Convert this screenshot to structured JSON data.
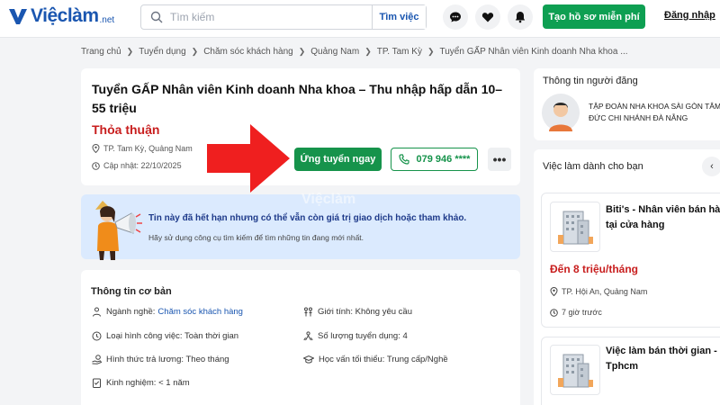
{
  "header": {
    "logo_text": "Việclàm",
    "logo_suffix": ".net",
    "search_placeholder": "Tìm kiếm",
    "search_button": "Tìm việc",
    "create_profile": "Tạo hồ sơ miễn phí",
    "login": "Đăng nhập",
    "icons": [
      "chat-icon",
      "heart-icon",
      "bell-icon"
    ]
  },
  "breadcrumb": [
    "Trang chủ",
    "Tuyển dụng",
    "Chăm sóc khách hàng",
    "Quảng Nam",
    "TP. Tam Kỳ",
    "Tuyển GẤP Nhân viên Kinh doanh Nha khoa ..."
  ],
  "job": {
    "title": "Tuyển GẤP Nhân viên Kinh doanh Nha khoa – Thu nhập hấp dẫn 10–55 triệu",
    "salary": "Thỏa thuận",
    "location": "TP. Tam Kỳ, Quảng Nam",
    "updated": "Cập nhật: 22/10/2025",
    "apply_label": "Ứng tuyển ngay",
    "phone_label": "079 946 ****",
    "more_label": "•••"
  },
  "notice": {
    "title": "Tin này đã hết hạn nhưng có thể vẫn còn giá trị giao dịch hoặc tham khảo.",
    "subtitle": "Hãy sử dụng công cụ tìm kiếm để tìm những tin đang mới nhất.",
    "watermark": "Việclàm"
  },
  "basic_info": {
    "title": "Thông tin cơ bản",
    "industry_label": "Ngành nghề:",
    "industry_value": "Chăm sóc khách hàng",
    "gender": "Giới tính: Không yêu cầu",
    "job_type": "Loại hình công việc: Toàn thời gian",
    "quantity": "Số lượng tuyển dụng: 4",
    "pay_method": "Hình thức trả lương: Theo tháng",
    "education": "Học vấn tối thiểu: Trung cấp/Nghề",
    "experience": "Kinh nghiệm: < 1 năm"
  },
  "poster": {
    "title": "Thông tin người đăng",
    "company": "TẬP ĐOÀN NHA KHOA SÀI GÒN TÂM ĐỨC CHI NHÁNH ĐÀ NẴNG"
  },
  "suggested": {
    "title": "Việc làm dành cho bạn",
    "arrow": "‹",
    "items": [
      {
        "title_line1": "Biti's - Nhân viên bán hàng",
        "title_line2": "tại cửa hàng",
        "salary": "Đến 8 triệu/tháng",
        "location": "TP. Hội An, Quảng Nam",
        "time": "7 giờ trước"
      },
      {
        "title_line1": "Việc làm bán thời gian -",
        "title_line2": "Tphcm"
      }
    ]
  },
  "colors": {
    "brand_blue": "#1a56b0",
    "green": "#16934b",
    "red": "#c81e1e",
    "notice_bg": "#dbeafe"
  }
}
